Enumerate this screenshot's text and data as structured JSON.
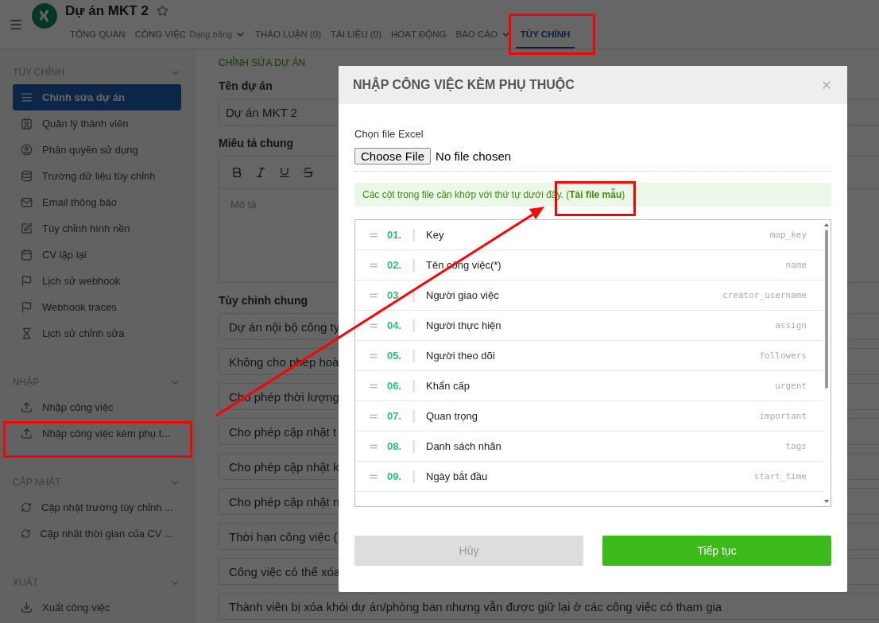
{
  "header": {
    "project_title": "Dự án MKT 2",
    "starred": false,
    "tabs": [
      {
        "label": "TỔNG QUAN",
        "selected": false,
        "dropdown": false
      },
      {
        "label": "CÔNG VIỆC",
        "sublabel": "Dạng bảng",
        "selected": false,
        "dropdown": true
      },
      {
        "label": "THẢO LUẬN (0)",
        "selected": false,
        "dropdown": false
      },
      {
        "label": "TÀI LIỆU (0)",
        "selected": false,
        "dropdown": false
      },
      {
        "label": "HOẠT ĐỘNG",
        "selected": false,
        "dropdown": false
      },
      {
        "label": "BÁO CÁO",
        "selected": false,
        "dropdown": true
      },
      {
        "label": "TÙY CHỈNH",
        "selected": true,
        "dropdown": false
      }
    ]
  },
  "sidebar": {
    "sections": [
      {
        "title": "TÙY CHỈNH",
        "expanded": true,
        "items": [
          {
            "label": "Chỉnh sửa dự án",
            "selected": true
          },
          {
            "label": "Quản lý thành viên",
            "selected": false
          },
          {
            "label": "Phân quyền sử dụng",
            "selected": false
          },
          {
            "label": "Trường dữ liệu tùy chỉnh",
            "selected": false
          },
          {
            "label": "Email thông báo",
            "selected": false
          },
          {
            "label": "Tùy chỉnh hình nền",
            "selected": false
          },
          {
            "label": "CV lặp lại",
            "selected": false
          },
          {
            "label": "Lịch sử webhook",
            "selected": false
          },
          {
            "label": "Webhook traces",
            "selected": false
          },
          {
            "label": "Lịch sử chỉnh sửa",
            "selected": false
          }
        ]
      },
      {
        "title": "NHẬP",
        "expanded": true,
        "items": [
          {
            "label": "Nhập công việc",
            "selected": false
          },
          {
            "label": "Nhập công việc kèm phụ t...",
            "selected": false
          }
        ]
      },
      {
        "title": "CẬP NHẬT",
        "expanded": true,
        "items": [
          {
            "label": "Cập nhật trường tùy chỉnh ...",
            "selected": false
          },
          {
            "label": "Cập nhật thời gian của CV ...",
            "selected": false
          }
        ]
      },
      {
        "title": "XUẤT",
        "expanded": true,
        "items": [
          {
            "label": "Xuất công việc",
            "selected": false
          }
        ]
      }
    ]
  },
  "main": {
    "section_title": "CHỈNH SỬA DỰ ÁN",
    "name_label": "Tên dự án",
    "name_value": "Dự án MKT 2",
    "description_label": "Miêu tả chung",
    "description_placeholder": "Mô tả",
    "settings_title": "Tùy chỉnh chung",
    "settings": [
      "Dự án nội bộ công ty",
      "Không cho phép hoà",
      "Cho phép thời lượng",
      "Cho phép cập nhật t",
      "Cho phép cập nhật k",
      "Cho phép cập nhật n",
      "Thời hạn công việc (",
      "Công việc có thể xóa",
      "Thành viên bị xóa khỏi dự án/phòng ban nhưng vẫn được giữ lại ở các công việc có tham gia"
    ]
  },
  "dialog": {
    "title": "NHẬP CÔNG VIỆC KÈM PHỤ THUỘC",
    "file_label": "Chọn file Excel",
    "file_button": "Choose File",
    "file_status": "No file chosen",
    "hint_prefix": "Các cột trong file cần khớp với thứ tự dưới đây. (",
    "hint_link": "Tải file mẫu",
    "hint_suffix": ")",
    "columns": [
      {
        "number": "01.",
        "label": "Key",
        "key": "map_key"
      },
      {
        "number": "02.",
        "label": "Tên công việc(*)",
        "key": "name"
      },
      {
        "number": "03.",
        "label": "Người giao việc",
        "key": "creator_username"
      },
      {
        "number": "04.",
        "label": "Người thực hiện",
        "key": "assign"
      },
      {
        "number": "05.",
        "label": "Người theo dõi",
        "key": "followers"
      },
      {
        "number": "06.",
        "label": "Khẩn cấp",
        "key": "urgent"
      },
      {
        "number": "07.",
        "label": "Quan trọng",
        "key": "important"
      },
      {
        "number": "08.",
        "label": "Danh sách nhãn",
        "key": "tags"
      },
      {
        "number": "09.",
        "label": "Ngày bắt đầu",
        "key": "start_time"
      }
    ],
    "buttons": [
      {
        "label": "Hủy",
        "kind": "secondary"
      },
      {
        "label": "Tiếp tục",
        "kind": "primary"
      }
    ]
  }
}
